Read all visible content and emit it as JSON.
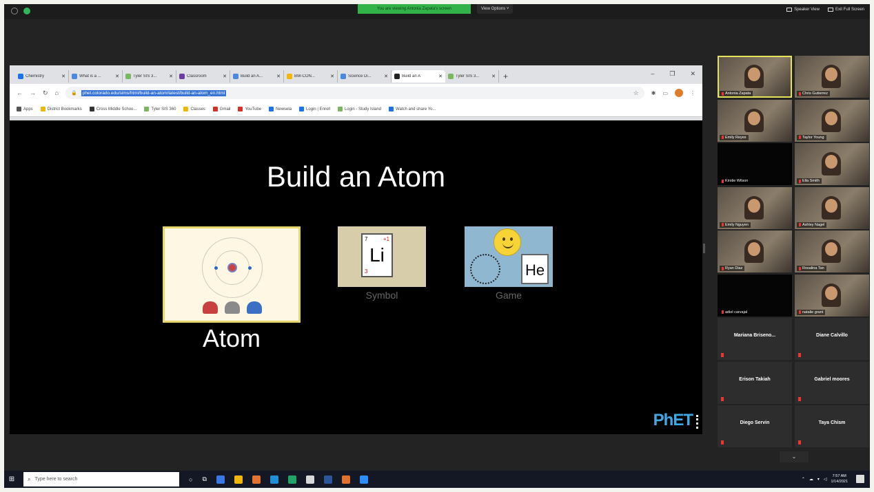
{
  "zoom": {
    "share_banner": "You are viewing Antonia Zapata's screen",
    "view_options": "View Options ˅",
    "speaker_view": "Speaker View",
    "exit_full_screen": "Exit Full Screen"
  },
  "browser": {
    "tabs": [
      {
        "label": "Chemistry",
        "color": "#1a73e8"
      },
      {
        "label": "What is a ...",
        "color": "#4a89dc"
      },
      {
        "label": "Tyler SIS 3...",
        "color": "#7bb662"
      },
      {
        "label": "Classroom",
        "color": "#6a3fa0"
      },
      {
        "label": "Build an A...",
        "color": "#4a89dc"
      },
      {
        "label": "BW-CON...",
        "color": "#f2b705"
      },
      {
        "label": "Science Di...",
        "color": "#4a89dc"
      },
      {
        "label": "Build an A",
        "color": "#222222",
        "active": true
      },
      {
        "label": "Tyler SIS 3...",
        "color": "#7bb662"
      }
    ],
    "new_tab": "+",
    "url": "phet.colorado.edu/sims/html/build-an-atom/latest/build-an-atom_en.html",
    "bookmarks": [
      {
        "label": "Apps",
        "color": "#555555"
      },
      {
        "label": "District Bookmarks",
        "color": "#f2b705"
      },
      {
        "label": "Cross Middle Schoo...",
        "color": "#333333"
      },
      {
        "label": "Tyler SIS 360",
        "color": "#7bb662"
      },
      {
        "label": "Classes",
        "color": "#f2b705"
      },
      {
        "label": "Gmail",
        "color": "#d93025"
      },
      {
        "label": "YouTube",
        "color": "#d93025"
      },
      {
        "label": "Newsela",
        "color": "#1a73e8"
      },
      {
        "label": "Login | Enroll",
        "color": "#1a73e8"
      },
      {
        "label": "Login - Study Island",
        "color": "#7bb662"
      },
      {
        "label": "Watch and share Yo...",
        "color": "#1a73e8"
      }
    ]
  },
  "sim": {
    "title": "Build an Atom",
    "screens": {
      "atom": "Atom",
      "symbol": "Symbol",
      "game": "Game"
    },
    "symbol_card": {
      "element": "Li",
      "mass": "7",
      "charge": "+1",
      "atomic_number": "3"
    },
    "game_card": {
      "element": "He"
    },
    "logo": "PhET"
  },
  "participants": [
    {
      "name": "Antonia Zapata",
      "type": "video",
      "active": true
    },
    {
      "name": "Chris Gutierrez",
      "type": "video"
    },
    {
      "name": "Emily Reyes",
      "type": "video"
    },
    {
      "name": "Taylor Young",
      "type": "video"
    },
    {
      "name": "Kirstie Wilson",
      "type": "black"
    },
    {
      "name": "Ella Smith",
      "type": "video"
    },
    {
      "name": "Emily Nguyen",
      "type": "video"
    },
    {
      "name": "Ashley Nagel",
      "type": "video"
    },
    {
      "name": "Ryan Diaz",
      "type": "video"
    },
    {
      "name": "Rosalina Tan",
      "type": "video"
    },
    {
      "name": "adiel carvajal",
      "type": "black"
    },
    {
      "name": "natalie grant",
      "type": "video"
    },
    {
      "name": "Mariana Briseno...",
      "type": "text"
    },
    {
      "name": "Diane Calvillo",
      "type": "text"
    },
    {
      "name": "Erison Takiah",
      "type": "text"
    },
    {
      "name": "Gabriel moores",
      "type": "text"
    },
    {
      "name": "Diego Servin",
      "type": "text"
    },
    {
      "name": "Taya Chism",
      "type": "text"
    }
  ],
  "taskbar": {
    "search_placeholder": "Type here to search",
    "time": "7:57 AM",
    "date": "1/14/2021",
    "pinned": [
      "#3b78e7",
      "#f2b705",
      "#e3742f",
      "#1f8fd6",
      "#21a366",
      "#d8d8d8",
      "#2b579a",
      "#e0712e",
      "#2d8cff"
    ]
  }
}
